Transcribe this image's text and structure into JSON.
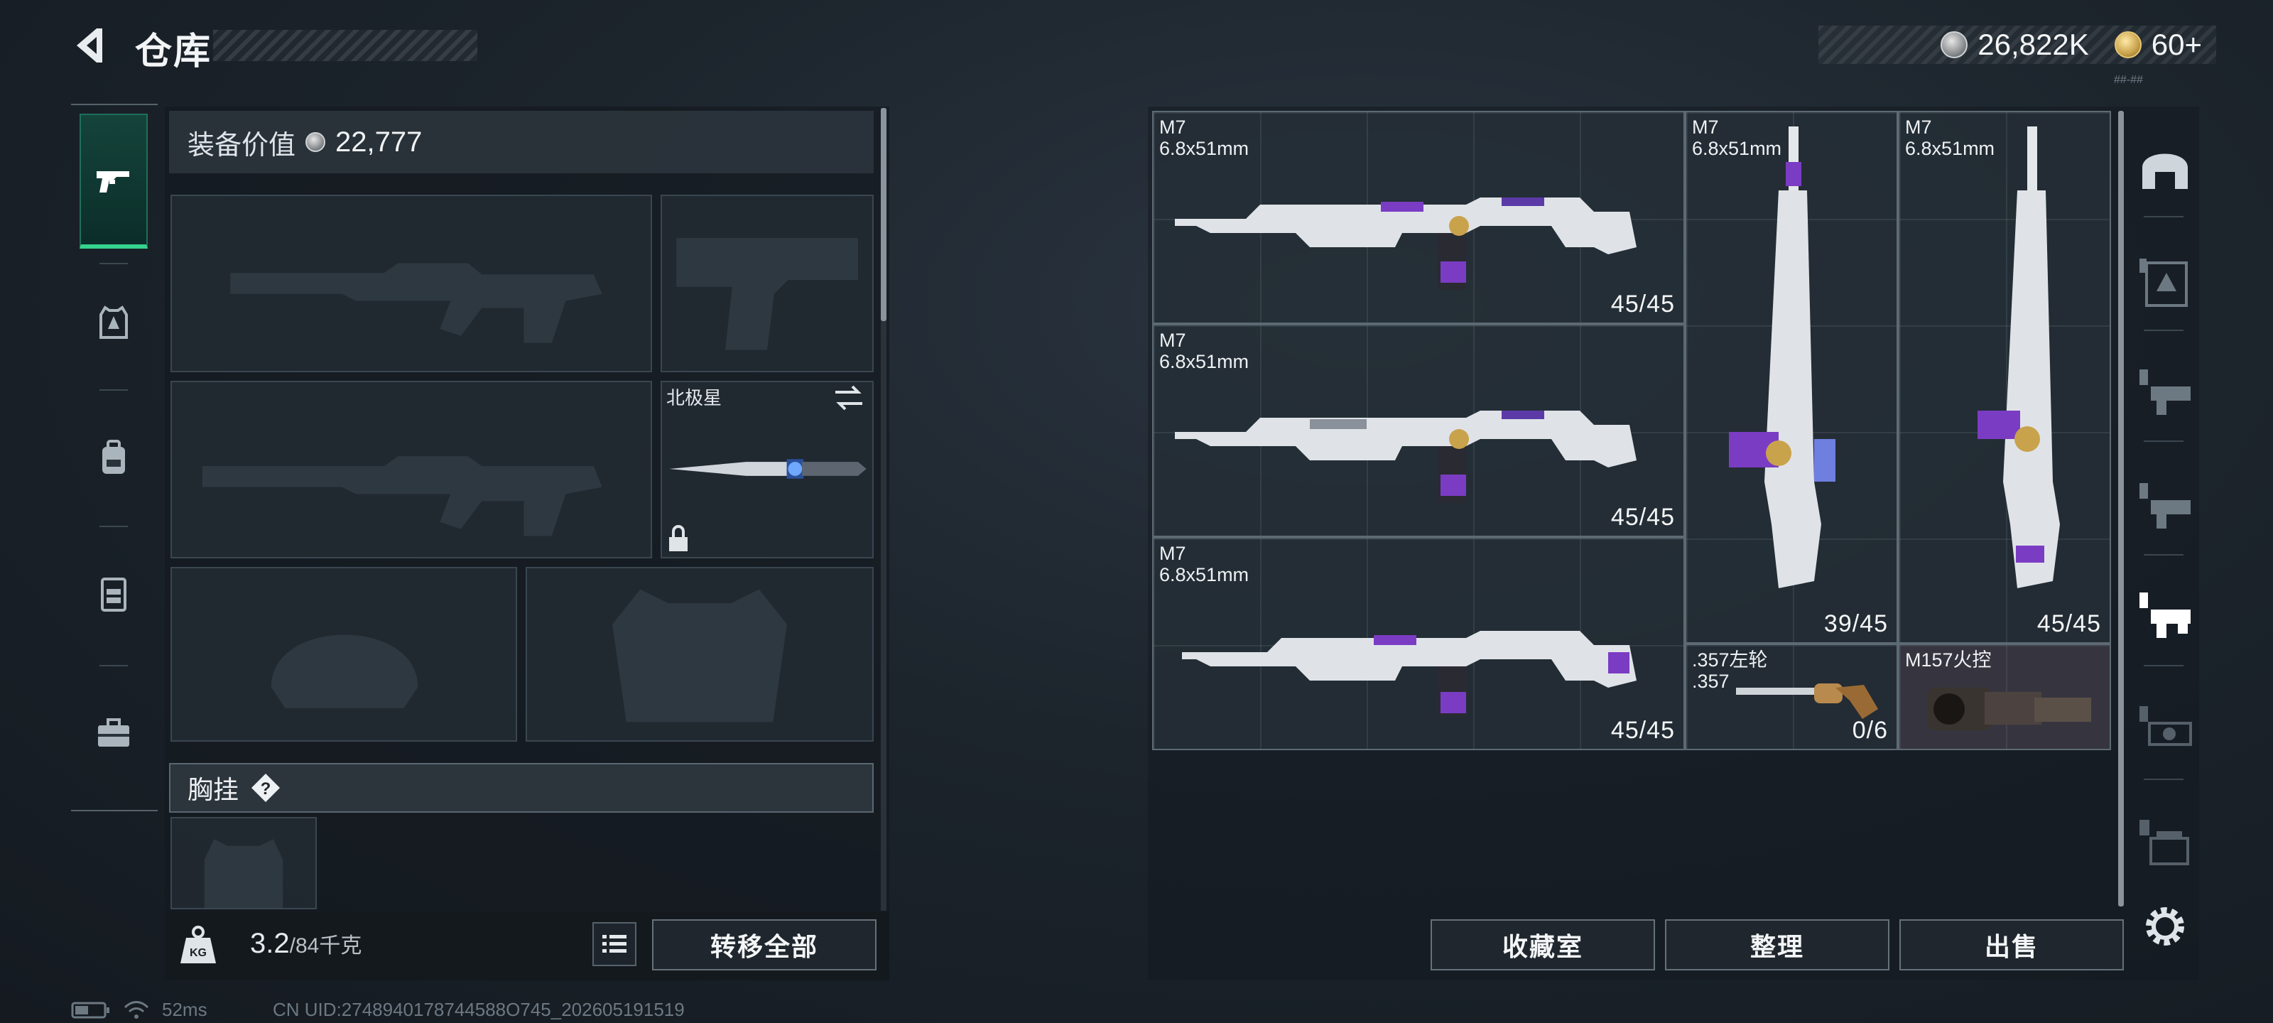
{
  "header": {
    "title": "仓库",
    "back_icon": "back-arrow-icon",
    "currency_silver": "26,822K",
    "currency_gold": "60+",
    "tiny_text": "##-##"
  },
  "left_nav": {
    "items": [
      {
        "icon": "pistol-icon",
        "active": true
      },
      {
        "icon": "armor-icon",
        "active": false
      },
      {
        "icon": "backpack-icon",
        "active": false
      },
      {
        "icon": "chest-rig-icon",
        "active": false
      },
      {
        "icon": "toolbox-icon",
        "active": false
      }
    ]
  },
  "equipment": {
    "value_label": "装备价值",
    "value": "22,777",
    "melee_name": "北极星",
    "chest_rig_label": "胸挂",
    "help_symbol": "?"
  },
  "weight": {
    "current": "3.2",
    "max": "/84千克",
    "icon_label": "KG"
  },
  "buttons": {
    "transfer_all": "转移全部",
    "collection": "收藏室",
    "organize": "整理",
    "sell": "出售"
  },
  "stash": {
    "items": [
      {
        "name": "M7",
        "caliber": "6.8x51mm",
        "ammo": "45/45",
        "orientation": "horizontal"
      },
      {
        "name": "M7",
        "caliber": "6.8x51mm",
        "ammo": "45/45",
        "orientation": "horizontal"
      },
      {
        "name": "M7",
        "caliber": "6.8x51mm",
        "ammo": "45/45",
        "orientation": "horizontal"
      },
      {
        "name": "M7",
        "caliber": "6.8x51mm",
        "ammo": "39/45",
        "orientation": "vertical"
      },
      {
        "name": "M7",
        "caliber": "6.8x51mm",
        "ammo": "45/45",
        "orientation": "vertical"
      },
      {
        "name": ".357左轮",
        "caliber": ".357",
        "ammo": "0/6",
        "orientation": "horizontal"
      },
      {
        "name": "M157火控",
        "caliber": "",
        "ammo": "",
        "orientation": "horizontal"
      }
    ]
  },
  "right_nav": {
    "items": [
      "helmet-icon",
      "armor-level-2-icon",
      "rig-level-3-icon",
      "rig-level-3b-icon",
      "rig-level-3-active-icon",
      "rig-level-5-icon",
      "rig-level-4-icon"
    ]
  },
  "status": {
    "ping": "52ms",
    "uid": "CN UID:2748940178744588O745_202605191519"
  },
  "colors": {
    "accent_green": "#35d38e",
    "weapon_purple": "#7b3cc4"
  }
}
